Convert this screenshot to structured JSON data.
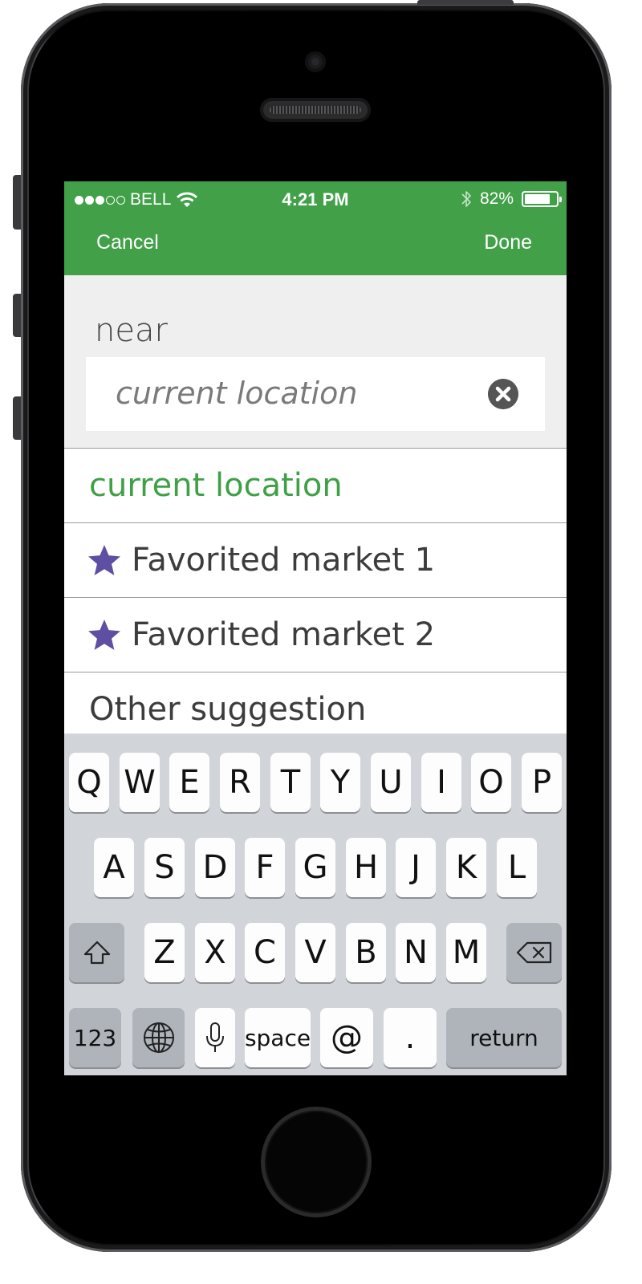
{
  "status_bar": {
    "carrier": "BELL",
    "time": "4:21 PM",
    "battery": "82%",
    "battery_level": 0.82,
    "signal_bars_filled": 3,
    "signal_bars_total": 5,
    "icons": [
      "signal-dots-icon",
      "wifi-icon",
      "bluetooth-icon",
      "battery-icon"
    ]
  },
  "nav": {
    "cancel_label": "Cancel",
    "done_label": "Done",
    "color": "#41a048"
  },
  "search": {
    "label": "near",
    "placeholder": "current location",
    "value": "",
    "clear_icon": "clear-x-icon"
  },
  "suggestions": {
    "current_location": "current location",
    "favorites": [
      "Favorited market 1",
      "Favorited market 2"
    ],
    "favorite_icon": "star-icon",
    "favorite_color": "#5e4fa2",
    "other": "Other suggestion"
  },
  "keyboard": {
    "row1": [
      "Q",
      "W",
      "E",
      "R",
      "T",
      "Y",
      "U",
      "I",
      "O",
      "P"
    ],
    "row2": [
      "A",
      "S",
      "D",
      "F",
      "G",
      "H",
      "J",
      "K",
      "L"
    ],
    "row3": [
      "Z",
      "X",
      "C",
      "V",
      "B",
      "N",
      "M"
    ],
    "numbers_label": "123",
    "space_label": "space",
    "at_label": "@",
    "period_label": ".",
    "return_label": "return",
    "icons": [
      "shift-icon",
      "delete-icon",
      "globe-icon",
      "microphone-icon"
    ]
  }
}
